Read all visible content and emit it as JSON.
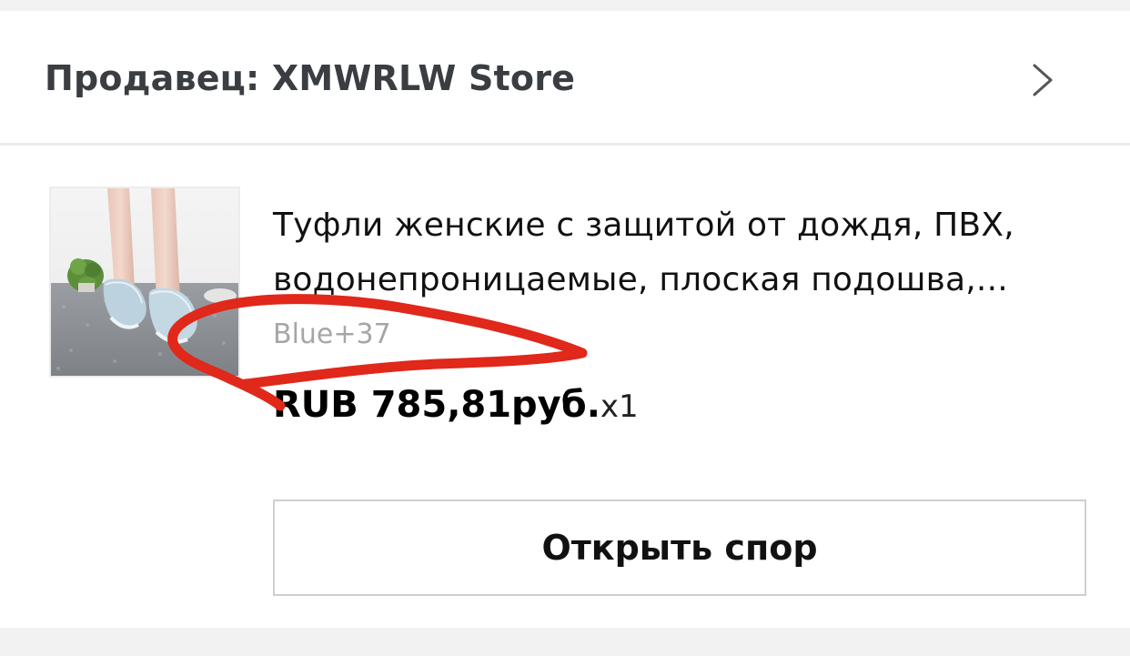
{
  "seller": {
    "label": "Продавец: XMWRLW Store",
    "chevron_icon": "chevron-right-icon"
  },
  "product": {
    "title_line1": "Туфли женские с защитой от дождя, ПВХ,",
    "title_line2": "водонепроницаемые, плоская подошва,...",
    "variant": "Blue+37",
    "price": "RUB 785,81руб.",
    "quantity": "x1",
    "image_icon": "product-photo-shoes"
  },
  "actions": {
    "dispute_label": "Открыть спор"
  },
  "colors": {
    "annotation_stroke": "#e0281b",
    "page_bg": "#f2f2f2",
    "card_bg": "#ffffff"
  }
}
